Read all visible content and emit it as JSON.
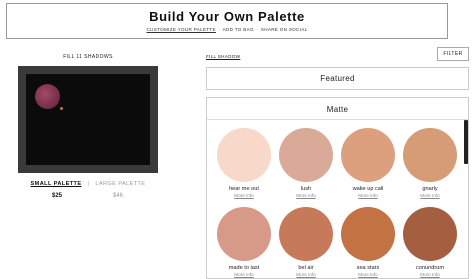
{
  "header": {
    "title": "Build Your Own Palette",
    "steps": [
      "CUSTOMIZE YOUR PALETTE",
      "ADD TO BAG",
      "SHARE ON SOCIAL"
    ],
    "separator": "·"
  },
  "palette": {
    "fill_label": "FILL 11 SHADOWS",
    "small_label": "SMALL PALETTE",
    "divider": "|",
    "large_label": "LARGE PALETTE",
    "small_price": "$25",
    "large_price": "$46"
  },
  "toolbar": {
    "fill_shadow": "FILL SHADOW",
    "filter": "FILTER"
  },
  "featured": {
    "label": "Featured"
  },
  "matte": {
    "title": "Matte",
    "more_info": "More Info",
    "shades": [
      {
        "name": "hear me out",
        "color": "#f8d8c8"
      },
      {
        "name": "lush",
        "color": "#d9aa98"
      },
      {
        "name": "wake up call",
        "color": "#dda07f"
      },
      {
        "name": "gnarly",
        "color": "#d69c76"
      },
      {
        "name": "made to last",
        "color": "#d89a88"
      },
      {
        "name": "bel air",
        "color": "#c77a59"
      },
      {
        "name": "sea stars",
        "color": "#c27243"
      },
      {
        "name": "conundrum",
        "color": "#a45e40"
      }
    ]
  }
}
